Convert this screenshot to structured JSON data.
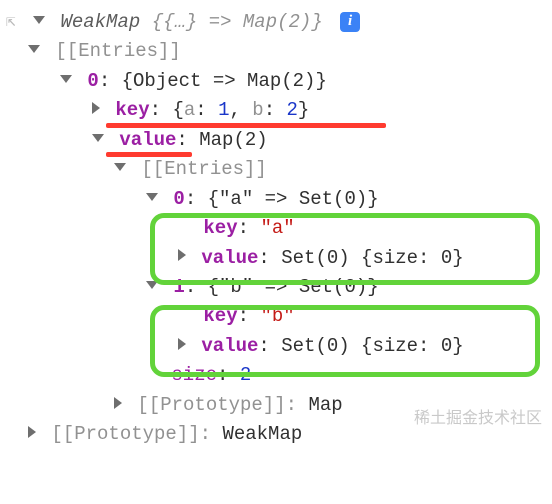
{
  "root": {
    "label": "WeakMap",
    "summary_open": "{{…} => Map(2)}"
  },
  "entries_label": "[[Entries]]",
  "entry0": {
    "index": "0",
    "summary": "{Object => Map(2)}",
    "key_label": "key",
    "key_open": "{",
    "key_a": "a",
    "key_a_val": "1",
    "key_sep": ", ",
    "key_b": "b",
    "key_b_val": "2",
    "key_close": "}",
    "value_label": "value",
    "value_summary": "Map(2)",
    "inner_entries_label": "[[Entries]]",
    "e0": {
      "index": "0",
      "summary": "{\"a\" => Set(0)}",
      "key_label": "key",
      "key_value": "\"a\"",
      "value_label": "value",
      "value_value": "Set(0) {size: 0}"
    },
    "e1": {
      "index": "1",
      "summary": "{\"b\" => Set(0)}",
      "key_label": "key",
      "key_value": "\"b\"",
      "value_label": "value",
      "value_value": "Set(0) {size: 0}"
    },
    "size_label": "size",
    "size_value": "2",
    "proto_label": "[[Prototype]]",
    "proto_value": "Map"
  },
  "outer_proto_label": "[[Prototype]]",
  "outer_proto_value": "WeakMap",
  "colon": ": ",
  "watermark": "稀土掘金技术社区"
}
